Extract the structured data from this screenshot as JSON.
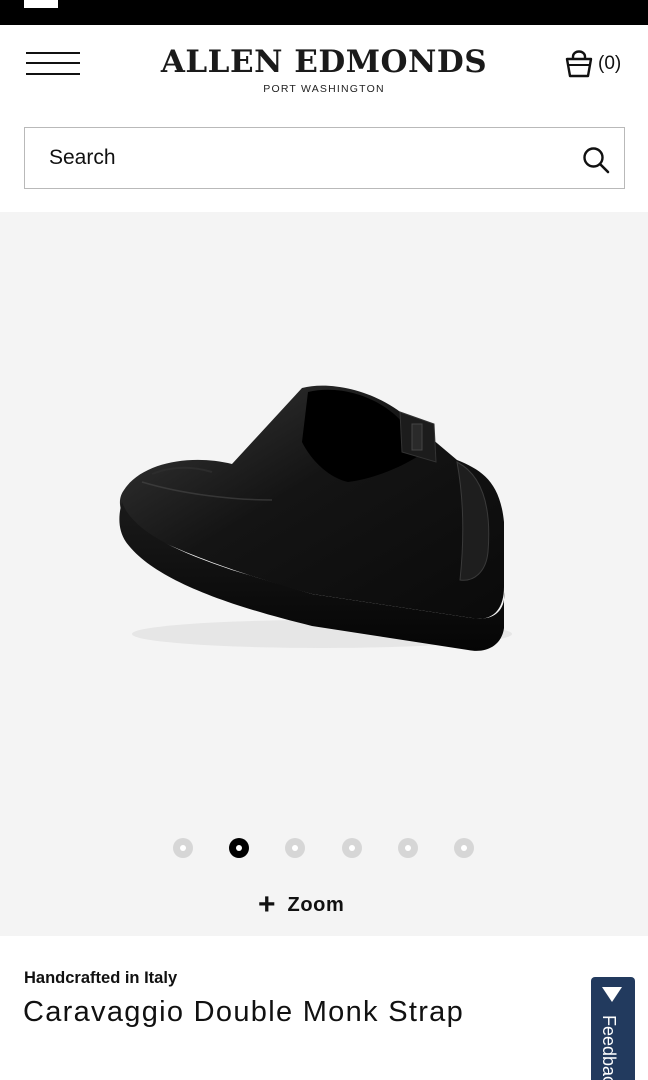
{
  "brand": {
    "name": "ALLEN EDMONDS",
    "location": "PORT WASHINGTON"
  },
  "icons": {
    "menu": "hamburger-menu-icon",
    "cart": "shopping-bag-icon",
    "search": "search-icon",
    "zoom": "plus-icon",
    "feedback": "triangle-down-icon"
  },
  "cart": {
    "count": "(0)"
  },
  "search": {
    "placeholder": "Search"
  },
  "gallery": {
    "image_count": 6,
    "active_index": 1,
    "zoom_plus": "+",
    "zoom_label": "Zoom",
    "background": "#f4f4f4"
  },
  "product": {
    "origin": "Handcrafted in Italy",
    "name": "Caravaggio Double Monk Strap"
  },
  "feedback": {
    "label": "Feedback",
    "color": "#223a5e"
  }
}
